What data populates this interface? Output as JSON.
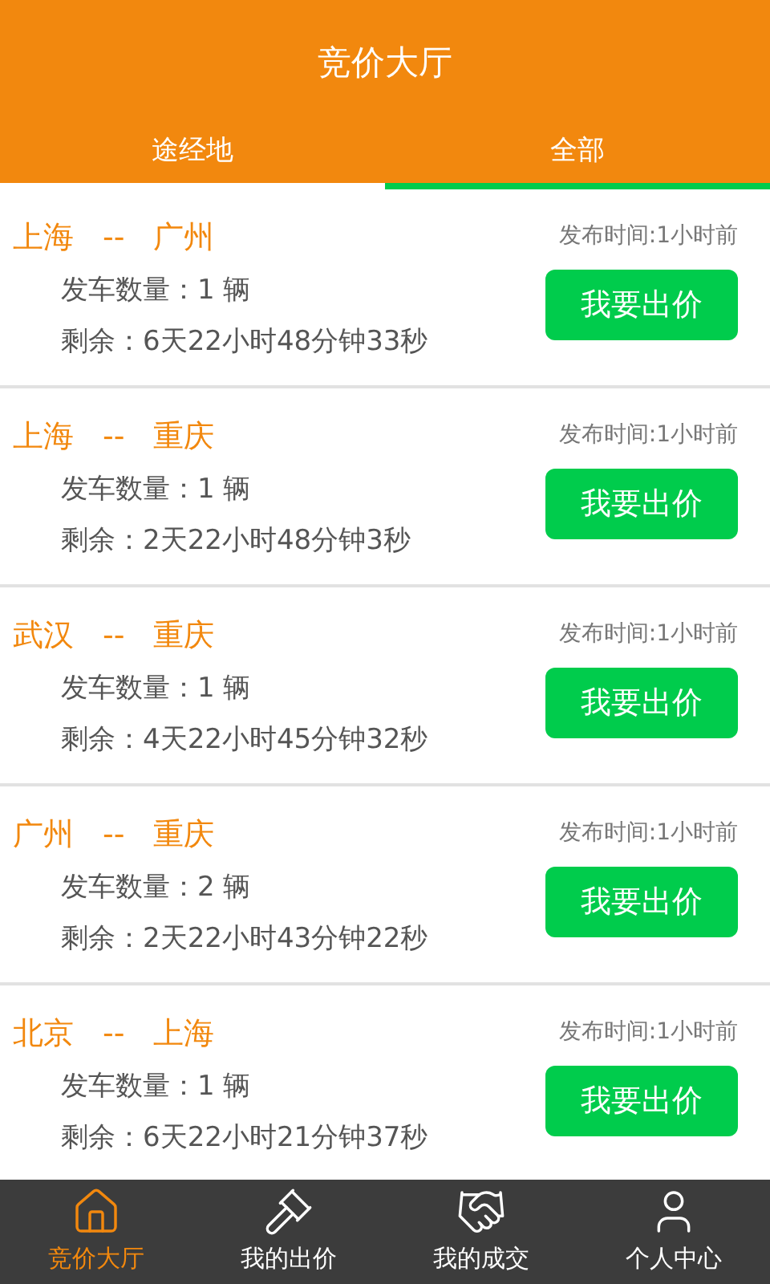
{
  "title": "竞价大厅",
  "tabs": [
    {
      "label": "途经地",
      "selected": false
    },
    {
      "label": "全部",
      "selected": true
    }
  ],
  "listings": [
    {
      "from": "上海",
      "separator": "--",
      "to": "广州",
      "quantity": "发车数量：1 辆",
      "remaining": "剩余：6天22小时48分钟33秒",
      "posted": "发布时间:1小时前",
      "button": "我要出价"
    },
    {
      "from": "上海",
      "separator": "--",
      "to": "重庆",
      "quantity": "发车数量：1 辆",
      "remaining": "剩余：2天22小时48分钟3秒",
      "posted": "发布时间:1小时前",
      "button": "我要出价"
    },
    {
      "from": "武汉",
      "separator": "--",
      "to": "重庆",
      "quantity": "发车数量：1 辆",
      "remaining": "剩余：4天22小时45分钟32秒",
      "posted": "发布时间:1小时前",
      "button": "我要出价"
    },
    {
      "from": "广州",
      "separator": "--",
      "to": "重庆",
      "quantity": "发车数量：2 辆",
      "remaining": "剩余：2天22小时43分钟22秒",
      "posted": "发布时间:1小时前",
      "button": "我要出价"
    },
    {
      "from": "北京",
      "separator": "--",
      "to": "上海",
      "quantity": "发车数量：1 辆",
      "remaining": "剩余：6天22小时21分钟37秒",
      "posted": "发布时间:1小时前",
      "button": "我要出价"
    }
  ],
  "nav": [
    {
      "label": "竞价大厅",
      "selected": true
    },
    {
      "label": "我的出价",
      "selected": false
    },
    {
      "label": "我的成交",
      "selected": false
    },
    {
      "label": "个人中心",
      "selected": false
    }
  ]
}
